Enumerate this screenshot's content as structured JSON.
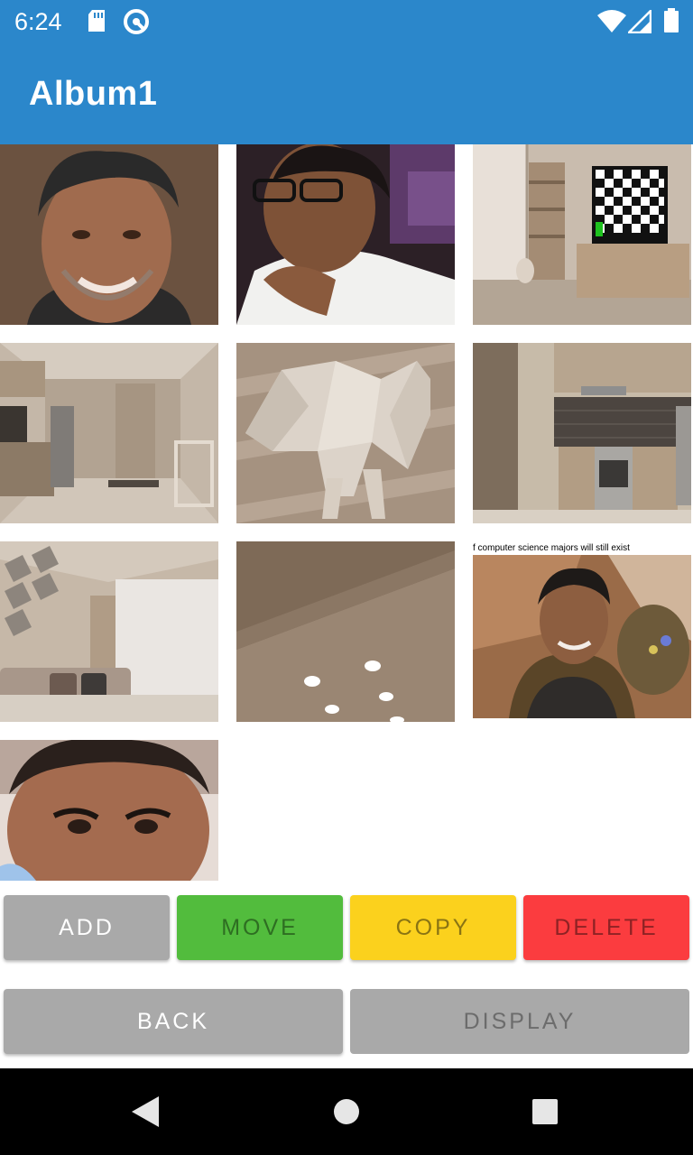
{
  "status_bar": {
    "time": "6:24",
    "icons": [
      "sd-card-icon",
      "vpn-key-icon",
      "wifi-icon",
      "cell-signal-icon",
      "battery-icon"
    ]
  },
  "app_bar": {
    "title": "Album1"
  },
  "grid": {
    "photos": [
      {
        "name": "photo-portrait-smiling"
      },
      {
        "name": "photo-portrait-thinking"
      },
      {
        "name": "photo-room-tv"
      },
      {
        "name": "photo-kitchen-hallway"
      },
      {
        "name": "photo-lowpoly-dog"
      },
      {
        "name": "photo-kitchen-stove"
      },
      {
        "name": "photo-living-room"
      },
      {
        "name": "photo-ceiling-lights"
      },
      {
        "name": "photo-meme",
        "caption": "f computer science majors will still exist"
      },
      {
        "name": "photo-portrait-closeup"
      }
    ]
  },
  "buttons": {
    "add": "ADD",
    "move": "MOVE",
    "copy": "COPY",
    "delete": "DELETE",
    "back": "BACK",
    "display": "DISPLAY"
  },
  "nav_bar": {
    "icons": [
      "back-triangle-icon",
      "home-circle-icon",
      "recents-square-icon"
    ]
  },
  "colors": {
    "app_bar": "#2b87cb",
    "move": "#52bc3d",
    "copy": "#fbd11d",
    "delete": "#fb3c3f",
    "neutral": "#a9a9a9"
  }
}
